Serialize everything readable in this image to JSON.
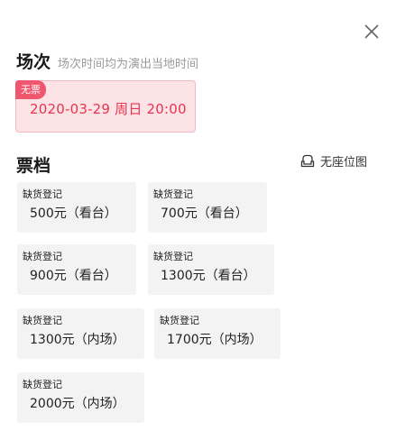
{
  "header": {
    "close_icon": "close-icon"
  },
  "session": {
    "title": "场次",
    "note": "场次时间均为演出当地时间",
    "selected": {
      "badge": "无票",
      "date": "2020-03-29 周日 20:00"
    }
  },
  "tiers": {
    "title": "票档",
    "seatmap_label": "无座位图",
    "items": [
      {
        "status": "缺货登记",
        "price": "500元（看台）"
      },
      {
        "status": "缺货登记",
        "price": "700元（看台）"
      },
      {
        "status": "缺货登记",
        "price": "900元（看台）"
      },
      {
        "status": "缺货登记",
        "price": "1300元（看台）"
      },
      {
        "status": "缺货登记",
        "price": "1300元（内场）"
      },
      {
        "status": "缺货登记",
        "price": "1700元（内场）"
      },
      {
        "status": "缺货登记",
        "price": "2000元（内场）"
      }
    ]
  },
  "colors": {
    "accent": "#e8344f",
    "badge": "#f0566e",
    "selected_bg": "#fbe3e6",
    "tier_bg": "#f3f3f3"
  }
}
